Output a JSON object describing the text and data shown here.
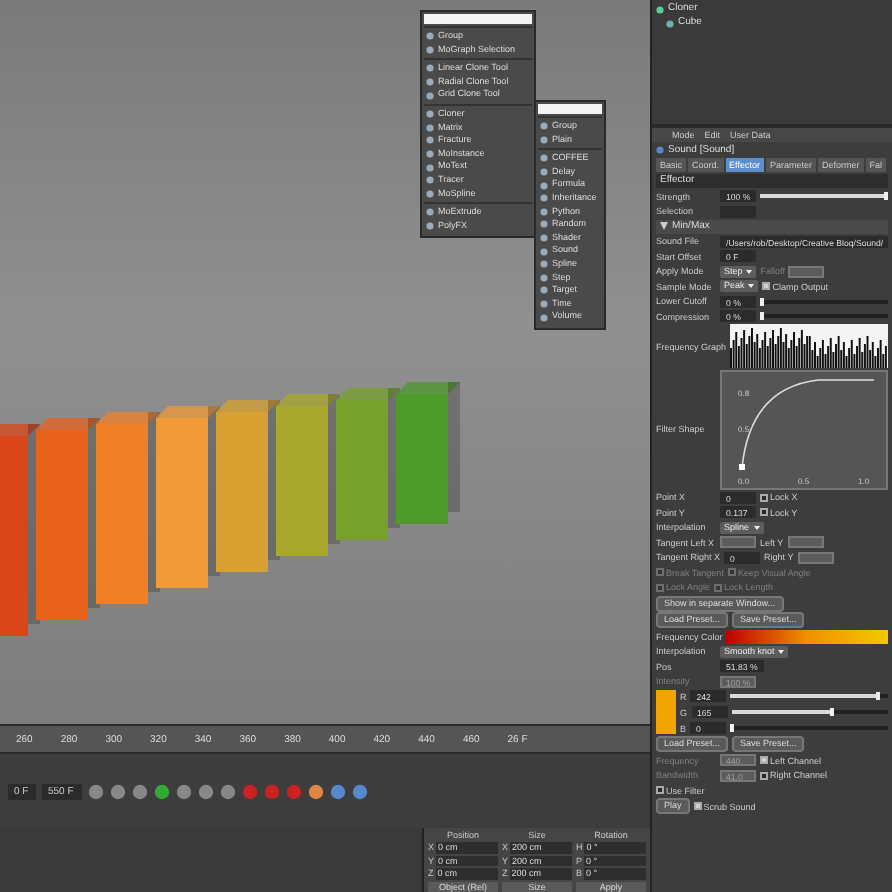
{
  "menus": [
    {
      "groups": [
        [
          "Group",
          "MoGraph Selection"
        ],
        [
          "Linear Clone Tool",
          "Radial Clone Tool",
          "Grid Clone Tool"
        ],
        [
          "Cloner",
          "Matrix",
          "Fracture",
          "MoInstance",
          "MoText",
          "Tracer",
          "MoSpline"
        ],
        [
          "MoExtrude",
          "PolyFX"
        ]
      ]
    },
    {
      "groups": [
        [
          "Group",
          "Plain"
        ],
        [
          "COFFEE",
          "Delay",
          "Formula",
          "Inheritance",
          "Python",
          "Random",
          "Shader",
          "Sound",
          "Spline",
          "Step",
          "Target",
          "Time",
          "Volume"
        ]
      ]
    }
  ],
  "timeline": {
    "ticks": [
      "260",
      "280",
      "300",
      "320",
      "340",
      "360",
      "380",
      "400",
      "420",
      "440",
      "460"
    ],
    "current_frame": "26 F"
  },
  "transport": {
    "start_field": "0 F",
    "end_field": "550 F"
  },
  "coordinates": {
    "headers": [
      "Position",
      "Size",
      "Rotation"
    ],
    "rows": [
      {
        "axis": "X",
        "position": "0 cm",
        "size_axis": "X",
        "size": "200 cm",
        "rotation_axis": "H",
        "rotation": "0 °"
      },
      {
        "axis": "Y",
        "position": "0 cm",
        "size_axis": "Y",
        "size": "200 cm",
        "rotation_axis": "P",
        "rotation": "0 °"
      },
      {
        "axis": "Z",
        "position": "0 cm",
        "size_axis": "Z",
        "size": "200 cm",
        "rotation_axis": "B",
        "rotation": "0 °"
      }
    ],
    "mode": "Object (Rel)",
    "size_mode": "Size",
    "apply": "Apply"
  },
  "object_manager": {
    "objects": [
      {
        "name": "Cloner",
        "children": [
          {
            "name": "Cube"
          }
        ]
      }
    ]
  },
  "attributes": {
    "menu": [
      "Mode",
      "Edit",
      "User Data"
    ],
    "title": "Sound [Sound]",
    "tabs": [
      {
        "label": "Basic",
        "selected": false
      },
      {
        "label": "Coord.",
        "selected": false
      },
      {
        "label": "Effector",
        "selected": true
      },
      {
        "label": "Parameter",
        "selected": false
      },
      {
        "label": "Deformer",
        "selected": false
      },
      {
        "label": "Fal",
        "selected": false
      }
    ],
    "rows": [
      {
        "kind": "header",
        "label": "Effector"
      },
      {
        "kind": "row",
        "cells": [
          {
            "kind": "label",
            "text": "Strength"
          },
          {
            "kind": "slider",
            "value": "100 %",
            "level": 1
          }
        ]
      },
      {
        "kind": "row",
        "cells": [
          {
            "kind": "label",
            "text": "Selection"
          },
          {
            "kind": "field"
          }
        ]
      },
      {
        "kind": "section",
        "label": "Min/Max",
        "expanded": true
      },
      {
        "kind": "row",
        "cells": [
          {
            "kind": "label",
            "text": "Sound File"
          },
          {
            "kind": "field",
            "value": "/Users/rob/Desktop/Creative Bloq/Sound/"
          }
        ]
      },
      {
        "kind": "row",
        "cells": [
          {
            "kind": "label",
            "text": "Start Offset"
          },
          {
            "kind": "field",
            "value": "0 F"
          }
        ]
      },
      {
        "kind": "row",
        "cells": [
          {
            "kind": "label",
            "text": "Apply Mode"
          },
          {
            "kind": "dropdown",
            "value": "Step"
          },
          {
            "kind": "label",
            "text": "Falloff",
            "disabled": true
          },
          {
            "kind": "field",
            "disabled": true
          }
        ]
      },
      {
        "kind": "row",
        "cells": [
          {
            "kind": "label",
            "text": "Sample Mode"
          },
          {
            "kind": "dropdown",
            "value": "Peak"
          },
          {
            "kind": "check",
            "label": "Clamp Output",
            "checked": true,
            "disabled": false
          }
        ]
      },
      {
        "kind": "row",
        "cells": [
          {
            "kind": "label",
            "text": "Lower Cutoff"
          },
          {
            "kind": "slider",
            "value": "0 %",
            "level": 0
          }
        ]
      },
      {
        "kind": "row",
        "cells": [
          {
            "kind": "label",
            "text": "Compression"
          },
          {
            "kind": "slider",
            "value": "0 %",
            "level": 0
          }
        ]
      },
      {
        "kind": "row",
        "cells": [
          {
            "kind": "label",
            "text": "Frequency Graph"
          },
          {
            "kind": "graph"
          }
        ]
      },
      {
        "kind": "row",
        "cells": [
          {
            "kind": "label",
            "text": "Filter Shape"
          },
          {
            "kind": "curve",
            "y_labels": [
              "0.8",
              "0.5"
            ],
            "x_labels": [
              "0.0",
              "0.5",
              "1.0"
            ]
          }
        ]
      },
      {
        "kind": "row",
        "cells": [
          {
            "kind": "label",
            "text": "Point X"
          },
          {
            "kind": "field",
            "value": "0"
          },
          {
            "kind": "check",
            "label": "Lock X",
            "checked": false,
            "disabled": false
          }
        ]
      },
      {
        "kind": "row",
        "cells": [
          {
            "kind": "label",
            "text": "Point Y"
          },
          {
            "kind": "field",
            "value": "0.137"
          },
          {
            "kind": "check",
            "label": "Lock Y",
            "checked": false,
            "disabled": false
          }
        ]
      },
      {
        "kind": "row",
        "cells": [
          {
            "kind": "label",
            "text": "Interpolation"
          },
          {
            "kind": "dropdown",
            "value": "Spline"
          }
        ]
      },
      {
        "kind": "row",
        "cells": [
          {
            "kind": "label",
            "text": "Tangent Left X"
          },
          {
            "kind": "field",
            "disabled": true
          },
          {
            "kind": "label",
            "text": "Left Y",
            "disabled": false
          },
          {
            "kind": "field",
            "disabled": true
          }
        ]
      },
      {
        "kind": "row",
        "cells": [
          {
            "kind": "label",
            "text": "Tangent Right X"
          },
          {
            "kind": "field",
            "value": "0"
          },
          {
            "kind": "label",
            "text": "Right Y",
            "disabled": false
          },
          {
            "kind": "field",
            "disabled": true
          }
        ]
      },
      {
        "kind": "row",
        "cells": [
          {
            "kind": "check",
            "label": "Break Tangent",
            "checked": false,
            "disabled": true
          },
          {
            "kind": "check",
            "label": "Keep Visual Angle",
            "checked": false,
            "disabled": true
          }
        ]
      },
      {
        "kind": "row",
        "cells": [
          {
            "kind": "check",
            "label": "Lock Angle",
            "checked": false,
            "disabled": true
          },
          {
            "kind": "check",
            "label": "Lock Length",
            "checked": false,
            "disabled": true
          }
        ]
      },
      {
        "kind": "row",
        "cells": [
          {
            "kind": "button",
            "label": "Show in separate Window..."
          }
        ]
      },
      {
        "kind": "row",
        "cells": [
          {
            "kind": "button",
            "label": "Load Preset..."
          },
          {
            "kind": "button",
            "label": "Save Preset..."
          }
        ]
      },
      {
        "kind": "row",
        "cells": [
          {
            "kind": "label",
            "text": "Frequency Color"
          },
          {
            "kind": "gradient"
          }
        ]
      },
      {
        "kind": "row",
        "cells": [
          {
            "kind": "label",
            "text": "Interpolation"
          },
          {
            "kind": "dropdown",
            "value": "Smooth knot"
          }
        ]
      },
      {
        "kind": "row",
        "cells": [
          {
            "kind": "label",
            "text": "Pos"
          },
          {
            "kind": "field",
            "value": "51.83 %"
          }
        ]
      },
      {
        "kind": "row",
        "cells": [
          {
            "kind": "label",
            "text": "Intensity",
            "disabled": true
          },
          {
            "kind": "field",
            "value": "100 %",
            "disabled": true
          }
        ]
      },
      {
        "kind": "row",
        "cells": [
          {
            "kind": "swatch"
          },
          {
            "kind": "channels",
            "items": [
              {
                "label": "R",
                "value": "242",
                "level": 0.95
              },
              {
                "label": "G",
                "value": "165",
                "level": 0.65
              },
              {
                "label": "B",
                "value": "0",
                "level": 0
              }
            ]
          }
        ]
      },
      {
        "kind": "row",
        "cells": [
          {
            "kind": "button",
            "label": "Load Preset..."
          },
          {
            "kind": "button",
            "label": "Save Preset..."
          }
        ]
      },
      {
        "kind": "row",
        "cells": [
          {
            "kind": "label",
            "text": "Frequency",
            "disabled": true
          },
          {
            "kind": "field",
            "value": "440",
            "disabled": true
          },
          {
            "kind": "check",
            "label": "Left Channel",
            "checked": true,
            "disabled": false
          }
        ]
      },
      {
        "kind": "row",
        "cells": [
          {
            "kind": "label",
            "text": "Bandwidth",
            "disabled": true
          },
          {
            "kind": "field",
            "value": "41.0",
            "disabled": true
          },
          {
            "kind": "check",
            "label": "Right Channel",
            "checked": false,
            "disabled": false
          }
        ]
      },
      {
        "kind": "row",
        "cells": [
          {
            "kind": "check",
            "label": "Use Filter",
            "checked": false,
            "disabled": false
          }
        ]
      },
      {
        "kind": "row",
        "cells": [
          {
            "kind": "button",
            "label": "Play"
          },
          {
            "kind": "check",
            "label": "Scrub Sound",
            "checked": true,
            "disabled": false
          }
        ]
      }
    ]
  }
}
